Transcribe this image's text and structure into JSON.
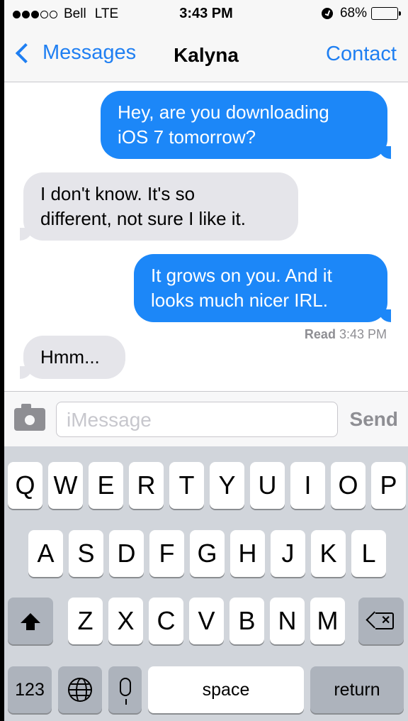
{
  "status_bar": {
    "signal_filled": 3,
    "signal_total": 5,
    "carrier": "Bell",
    "network": "LTE",
    "time": "3:43 PM",
    "battery": "68%",
    "battery_level": 0.68
  },
  "nav": {
    "back_label": "Messages",
    "title": "Kalyna",
    "contact_label": "Contact"
  },
  "messages": [
    {
      "direction": "outgoing",
      "lines": [
        "Hey, are you downloading",
        "iOS 7 tomorrow?"
      ]
    },
    {
      "direction": "incoming",
      "lines": [
        "I don't know. It's so",
        "different, not sure I like it."
      ]
    },
    {
      "direction": "outgoing",
      "lines": [
        "It grows on you. And it",
        "looks much nicer IRL."
      ]
    },
    {
      "direction": "incoming",
      "lines": [
        "Hmm..."
      ]
    }
  ],
  "read_receipt": {
    "label": "Read",
    "time": "3:43 PM"
  },
  "input_bar": {
    "placeholder": "iMessage",
    "send_label": "Send"
  },
  "keyboard": {
    "row1": [
      "Q",
      "W",
      "E",
      "R",
      "T",
      "Y",
      "U",
      "I",
      "O",
      "P"
    ],
    "row2": [
      "A",
      "S",
      "D",
      "F",
      "G",
      "H",
      "J",
      "K",
      "L"
    ],
    "row3": [
      "Z",
      "X",
      "C",
      "V",
      "B",
      "N",
      "M"
    ],
    "numbers_label": "123",
    "space_label": "space",
    "return_label": "return"
  },
  "colors": {
    "accent": "#1f7ff2",
    "outgoing_bubble": "#1c87f8",
    "incoming_bubble": "#e5e5ea",
    "keyboard_bg": "#d1d5db"
  }
}
